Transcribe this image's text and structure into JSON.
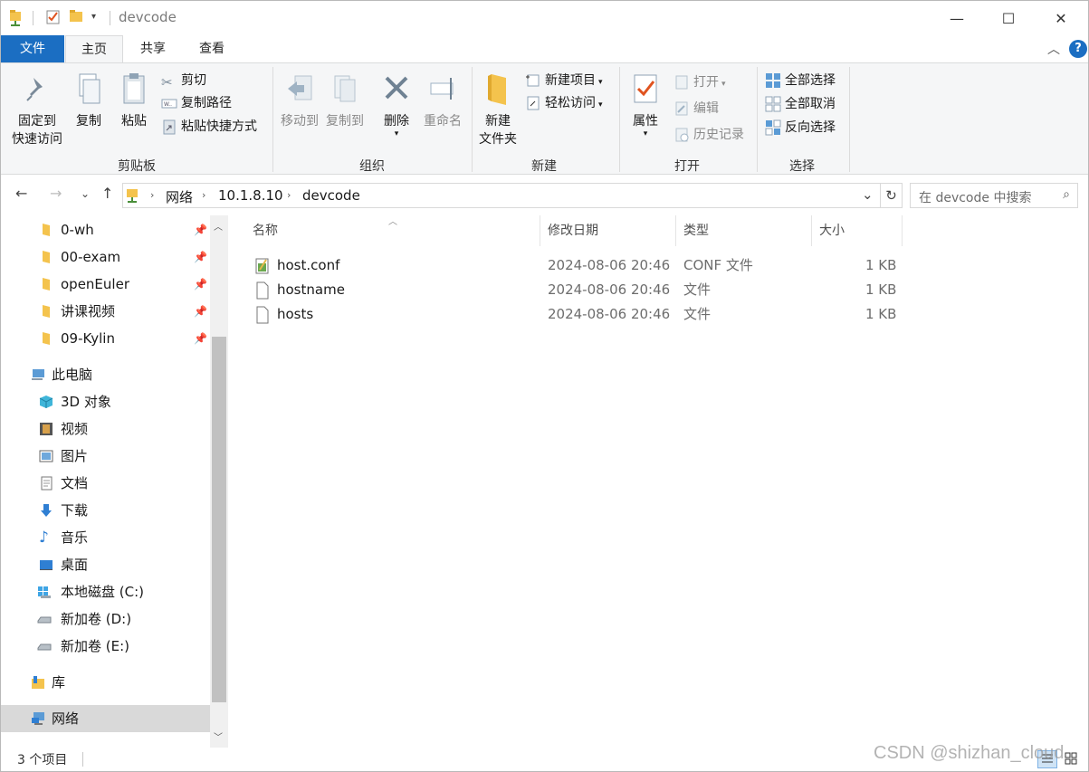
{
  "window": {
    "title": "devcode",
    "minimize": "—",
    "maximize": "☐",
    "close": "✕"
  },
  "ribbon_tabs": [
    "文件",
    "主页",
    "共享",
    "查看"
  ],
  "help": "?",
  "ribbon": {
    "clipboard": {
      "label": "剪贴板",
      "pin": [
        "固定到",
        "快速访问"
      ],
      "copy": "复制",
      "paste": "粘贴",
      "cut": "剪切",
      "copy_path": "复制路径",
      "paste_shortcut": "粘贴快捷方式"
    },
    "organize": {
      "label": "组织",
      "move_to": "移动到",
      "copy_to": "复制到",
      "delete": "删除",
      "rename": "重命名"
    },
    "new": {
      "label": "新建",
      "new_folder": [
        "新建",
        "文件夹"
      ],
      "new_item": "新建项目",
      "easy_access": "轻松访问"
    },
    "open": {
      "label": "打开",
      "properties": "属性",
      "open": "打开",
      "edit": "编辑",
      "history": "历史记录"
    },
    "select": {
      "label": "选择",
      "select_all": "全部选择",
      "select_none": "全部取消",
      "invert": "反向选择"
    }
  },
  "address": {
    "crumbs": [
      "网络",
      "10.1.8.10",
      "devcode"
    ],
    "search_placeholder": "在 devcode 中搜索"
  },
  "nav": {
    "quick_access": [
      "0-wh",
      "00-exam",
      "openEuler",
      "讲课视频",
      "09-Kylin"
    ],
    "this_pc": "此电脑",
    "pc_items": [
      "3D 对象",
      "视频",
      "图片",
      "文档",
      "下载",
      "音乐",
      "桌面",
      "本地磁盘 (C:)",
      "新加卷 (D:)",
      "新加卷 (E:)"
    ],
    "libraries": "库",
    "network": "网络"
  },
  "columns": [
    "名称",
    "修改日期",
    "类型",
    "大小"
  ],
  "files": [
    {
      "name": "host.conf",
      "date": "2024-08-06 20:46",
      "type": "CONF 文件",
      "size": "1 KB"
    },
    {
      "name": "hostname",
      "date": "2024-08-06 20:46",
      "type": "文件",
      "size": "1 KB"
    },
    {
      "name": "hosts",
      "date": "2024-08-06 20:46",
      "type": "文件",
      "size": "1 KB"
    }
  ],
  "status": {
    "count": "3 个项目"
  },
  "watermark": "CSDN @shizhan_cloud",
  "colors": {
    "accent": "#1b6ec2",
    "folder": "#f4c34d",
    "selection": "#d9d9d9"
  }
}
